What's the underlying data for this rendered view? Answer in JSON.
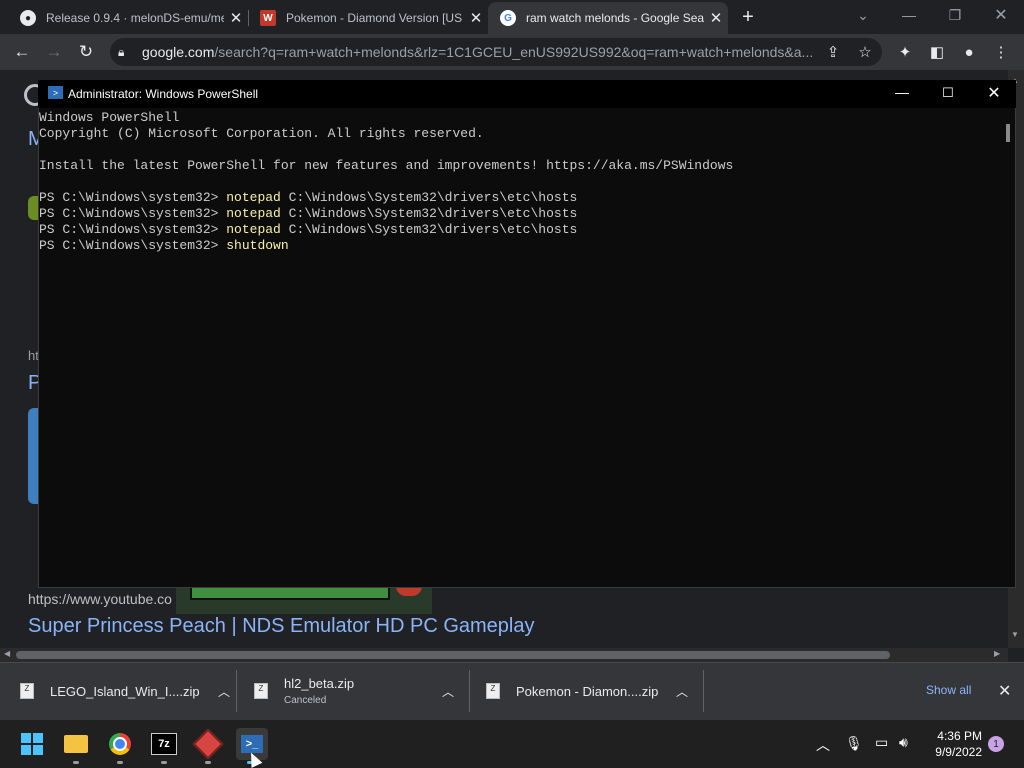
{
  "browser": {
    "tabs": [
      {
        "title": "Release 0.9.4 · melonDS-emu/me",
        "icon": "github-icon"
      },
      {
        "title": "Pokemon - Diamond Version [US",
        "icon": "wiki-icon"
      },
      {
        "title": "ram watch melonds - Google Sea",
        "icon": "google-icon"
      }
    ],
    "url_domain": "google.com",
    "url_rest": "/search?q=ram+watch+melonds&rlz=1C1GCEU_enUS992US992&oq=ram+watch+melonds&a..."
  },
  "page": {
    "left_letters": [
      "M",
      "P"
    ],
    "url_fragment": "ht",
    "result_url": "https://www.youtube.co",
    "result_title": "Super Princess Peach | NDS Emulator HD PC Gameplay"
  },
  "powershell": {
    "title": "Administrator: Windows PowerShell",
    "lines": [
      {
        "prompt": "Windows PowerShell",
        "cmd": ""
      },
      {
        "prompt": "Copyright (C) Microsoft Corporation. All rights reserved.",
        "cmd": ""
      },
      {
        "prompt": "",
        "cmd": ""
      },
      {
        "prompt": "Install the latest PowerShell for new features and improvements! https://aka.ms/PSWindows",
        "cmd": ""
      },
      {
        "prompt": "",
        "cmd": ""
      },
      {
        "prompt": "PS C:\\Windows\\system32> ",
        "cmd": "notepad",
        "args": " C:\\Windows\\System32\\drivers\\etc\\hosts"
      },
      {
        "prompt": "PS C:\\Windows\\system32> ",
        "cmd": "notepad",
        "args": " C:\\Windows\\System32\\drivers\\etc\\hosts"
      },
      {
        "prompt": "PS C:\\Windows\\system32> ",
        "cmd": "notepad",
        "args": " C:\\Windows\\System32\\drivers\\etc\\hosts"
      },
      {
        "prompt": "PS C:\\Windows\\system32> ",
        "cmd": "shutdown",
        "args": ""
      }
    ]
  },
  "downloads": {
    "items": [
      {
        "name": "LEGO_Island_Win_I....zip",
        "status": ""
      },
      {
        "name": "hl2_beta.zip",
        "status": "Canceled"
      },
      {
        "name": "Pokemon - Diamon....zip",
        "status": ""
      }
    ],
    "show_all": "Show all"
  },
  "taskbar": {
    "time": "4:36 PM",
    "date": "9/9/2022",
    "notification_count": "1",
    "apps": [
      "windows-start-icon",
      "file-explorer-icon",
      "chrome-icon",
      "7zip-icon",
      "melonds-icon",
      "powershell-icon"
    ]
  }
}
